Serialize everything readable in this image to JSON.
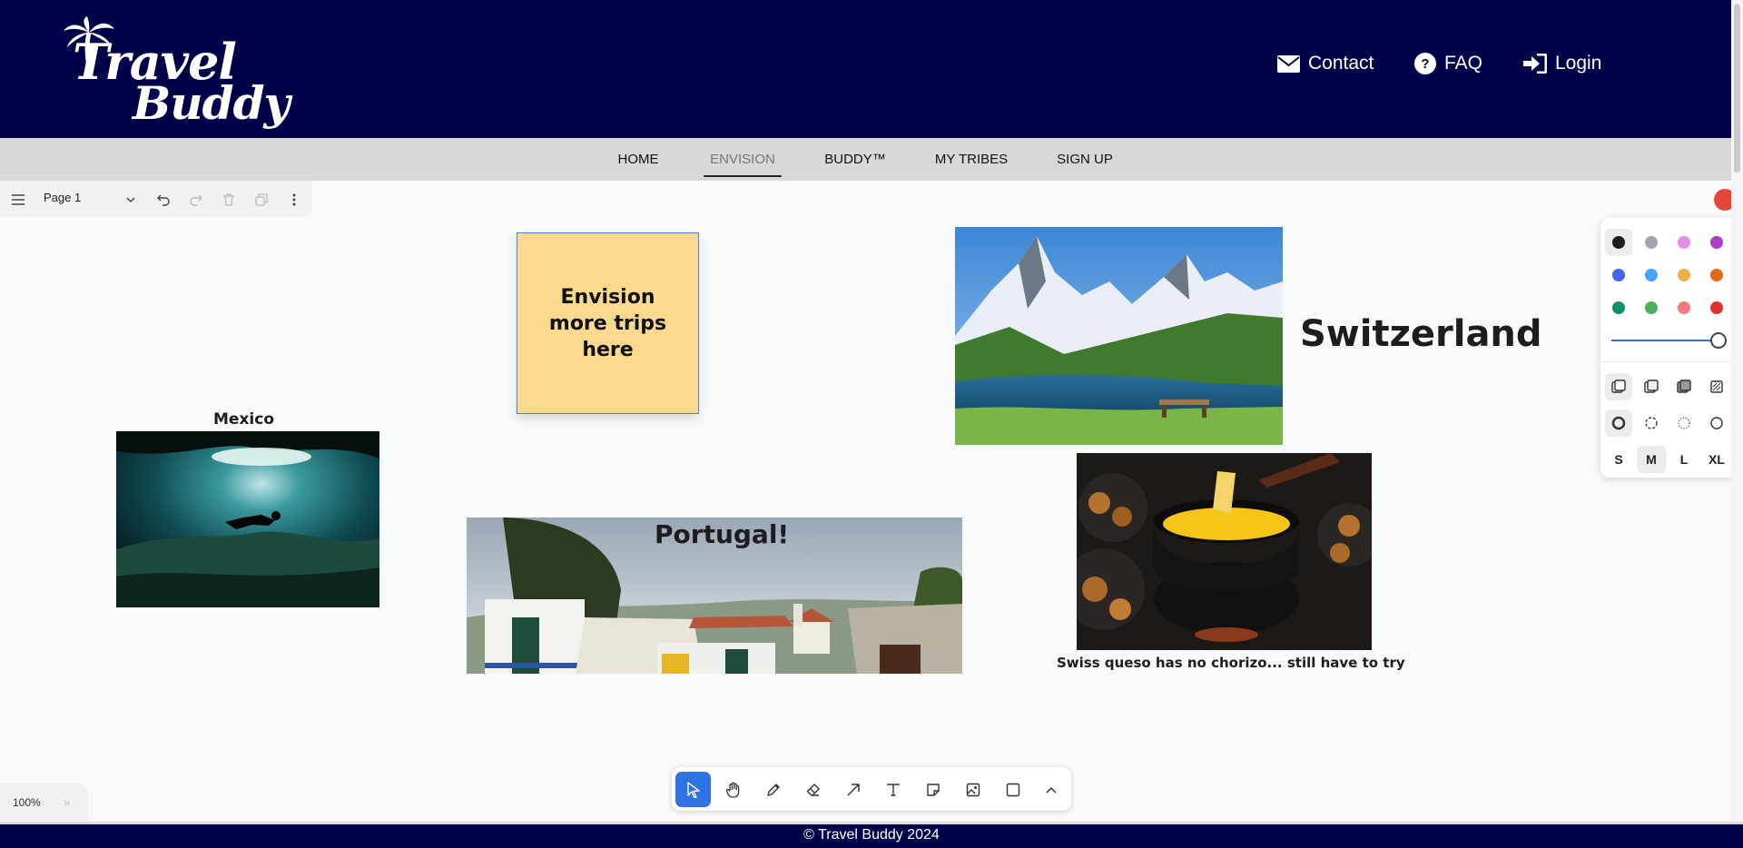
{
  "brand": {
    "logo_line1": "Travel",
    "logo_line2": "Buddy"
  },
  "header_links": [
    {
      "label": "Contact",
      "icon": "envelope-icon"
    },
    {
      "label": "FAQ",
      "icon": "question-circle-icon"
    },
    {
      "label": "Login",
      "icon": "sign-in-icon"
    }
  ],
  "nav": {
    "items": [
      "HOME",
      "ENVISION",
      "BUDDY™",
      "MY TRIBES",
      "SIGN UP"
    ],
    "active": "ENVISION"
  },
  "page_bar": {
    "page_name": "Page 1"
  },
  "board": {
    "sticky_note": "Envision more trips here",
    "labels": {
      "mexico": "Mexico",
      "switzerland": "Switzerland",
      "portugal": "Portugal!",
      "fondue_caption": "Swiss queso has no chorizo... still have to try"
    }
  },
  "style_panel": {
    "colors": [
      "#1d1d1d",
      "#9fa6b0",
      "#e38ce8",
      "#ae3ec9",
      "#4465e9",
      "#4ba1f1",
      "#f1ac4b",
      "#e16919",
      "#099268",
      "#4cb05e",
      "#f87777",
      "#e03131"
    ],
    "selected_color": "#1d1d1d",
    "sizes": [
      "S",
      "M",
      "L",
      "XL"
    ],
    "selected_size": "M"
  },
  "toolbar": {
    "tools": [
      "select-tool",
      "hand-tool",
      "draw-tool",
      "eraser-tool",
      "arrow-tool",
      "text-tool",
      "note-tool",
      "asset-tool",
      "rectangle-tool",
      "more-tools"
    ],
    "selected": "select-tool"
  },
  "zoom": {
    "level": "100%"
  },
  "footer": {
    "copyright": "© Travel Buddy 2024"
  },
  "accent_colors": {
    "header_bg": "#01014a",
    "nav_bg": "#d8d8d8",
    "selected_tool": "#2f72e2",
    "sticky_bg": "#fbd98e"
  }
}
